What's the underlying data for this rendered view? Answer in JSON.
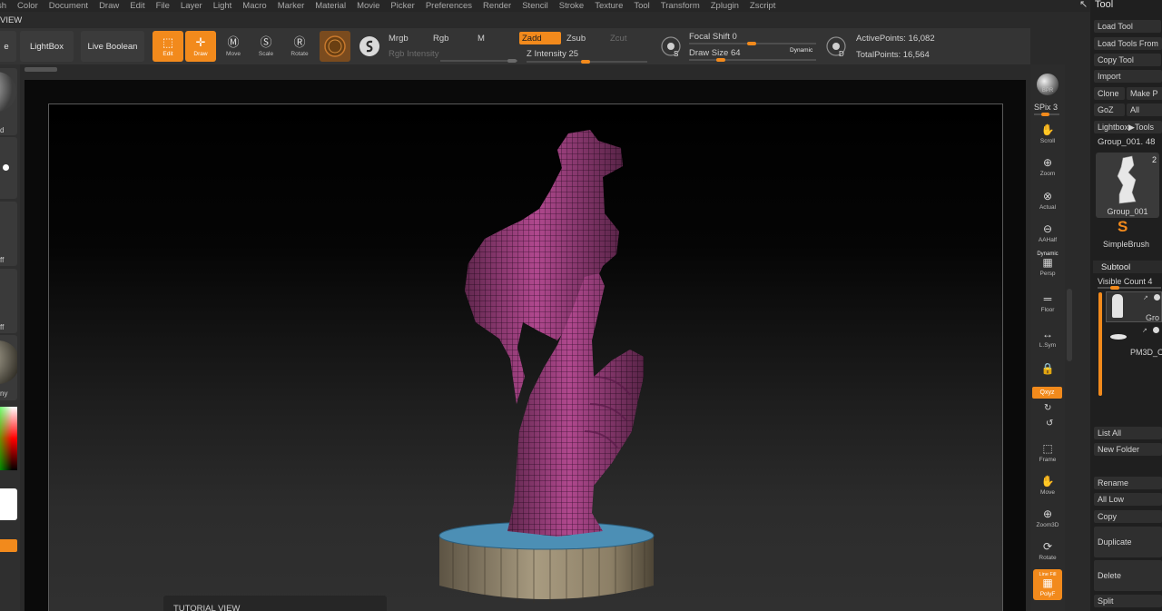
{
  "menu": [
    "sh",
    "Color",
    "Document",
    "Draw",
    "Edit",
    "File",
    "Layer",
    "Light",
    "Macro",
    "Marker",
    "Material",
    "Movie",
    "Picker",
    "Preferences",
    "Render",
    "Stencil",
    "Stroke",
    "Texture",
    "Tool",
    "Transform",
    "Zplugin",
    "Zscript"
  ],
  "view_label": "VIEW",
  "toolbar": {
    "home_label": "e",
    "lightbox_label": "LightBox",
    "live_boolean_label": "Live Boolean",
    "edit_label": "Edit",
    "draw_label": "Draw",
    "move_label": "Move",
    "scale_label": "Scale",
    "rotate_label": "Rotate",
    "mrgb": "Mrgb",
    "rgb": "Rgb",
    "m": "M",
    "rgb_intensity": "Rgb Intensity",
    "zadd": "Zadd",
    "zsub": "Zsub",
    "zcut": "Zcut",
    "z_intensity": "Z Intensity 25",
    "z_intensity_value": 25,
    "focal_shift": "Focal Shift 0",
    "focal_shift_value": 0,
    "draw_size": "Draw Size",
    "draw_size_value": "64",
    "dynamic": "Dynamic",
    "active_points": "ActivePoints: 16,082",
    "total_points": "TotalPoints: 16,564"
  },
  "left_shelf": {
    "labels": [
      "d",
      "ff",
      "ff",
      "ny"
    ]
  },
  "right_shelf": {
    "spix": "SPix 3",
    "buttons": [
      {
        "name": "bpr",
        "label": "BPR"
      },
      {
        "name": "scroll",
        "label": "Scroll"
      },
      {
        "name": "zoom",
        "label": "Zoom"
      },
      {
        "name": "actual",
        "label": "Actual"
      },
      {
        "name": "aahalf",
        "label": "AAHalf"
      },
      {
        "name": "persp",
        "label": "Persp"
      },
      {
        "name": "floor",
        "label": "Floor"
      },
      {
        "name": "lsym",
        "label": "L.Sym"
      },
      {
        "name": "xyz",
        "label": "Qxyz"
      },
      {
        "name": "frame",
        "label": "Frame"
      },
      {
        "name": "move",
        "label": "Move"
      },
      {
        "name": "zoom3d",
        "label": "Zoom3D"
      },
      {
        "name": "rotate",
        "label": "Rotate"
      },
      {
        "name": "polyf",
        "label": "PolyF"
      }
    ],
    "dynamic_label": "Dynamic",
    "line_fill_label": "Line Fill"
  },
  "tutorial_view": "TUTORIAL VIEW",
  "tool_palette": {
    "title": "Tool",
    "load_tool": "Load Tool",
    "load_tools_from": "Load Tools From",
    "copy_tool": "Copy Tool",
    "import": "Import",
    "clone": "Clone",
    "make_p": "Make P",
    "goz": "GoZ",
    "all": "All",
    "lightbox_tools": "Lightbox▶Tools",
    "group_name": "Group_001. 48",
    "thumb_count": "2",
    "thumb_label": "Group_001",
    "simple_brush": "SimpleBrush",
    "subtool": "Subtool",
    "visible_count": "Visible Count 4",
    "subtool_items": [
      "Gro",
      "PM3D_C"
    ],
    "list_all": "List All",
    "new_folder": "New Folder",
    "rename": "Rename",
    "all_low": "All Low",
    "copy": "Copy",
    "duplicate": "Duplicate",
    "delete": "Delete",
    "split": "Split"
  },
  "colors": {
    "accent": "#f28a1c",
    "mesh": "#b0488e",
    "base_top": "#4c8fb5",
    "base_side": "#8a7c62"
  }
}
